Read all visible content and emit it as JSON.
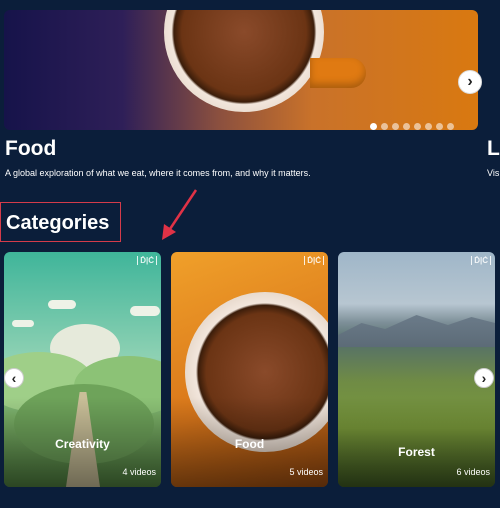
{
  "hero": {
    "title": "Food",
    "description": "A global exploration of what we eat, where it comes from, and why it matters.",
    "next_title": "Lo",
    "next_description": "Vis",
    "next_button": "›",
    "dots_total": 8,
    "dots_active_index": 0
  },
  "categories": {
    "heading": "Categories",
    "prev_button": "‹",
    "next_button": "›",
    "items": [
      {
        "name": "Creativity",
        "count": "4 videos",
        "logo": "Ď|Ć"
      },
      {
        "name": "Food",
        "count": "5 videos",
        "logo": "Ď|Ć"
      },
      {
        "name": "Forest",
        "count": "6 videos",
        "logo": "Ď|Ć"
      }
    ]
  },
  "colors": {
    "background": "#0b1e3a",
    "annotation_red": "#d43b4a"
  }
}
